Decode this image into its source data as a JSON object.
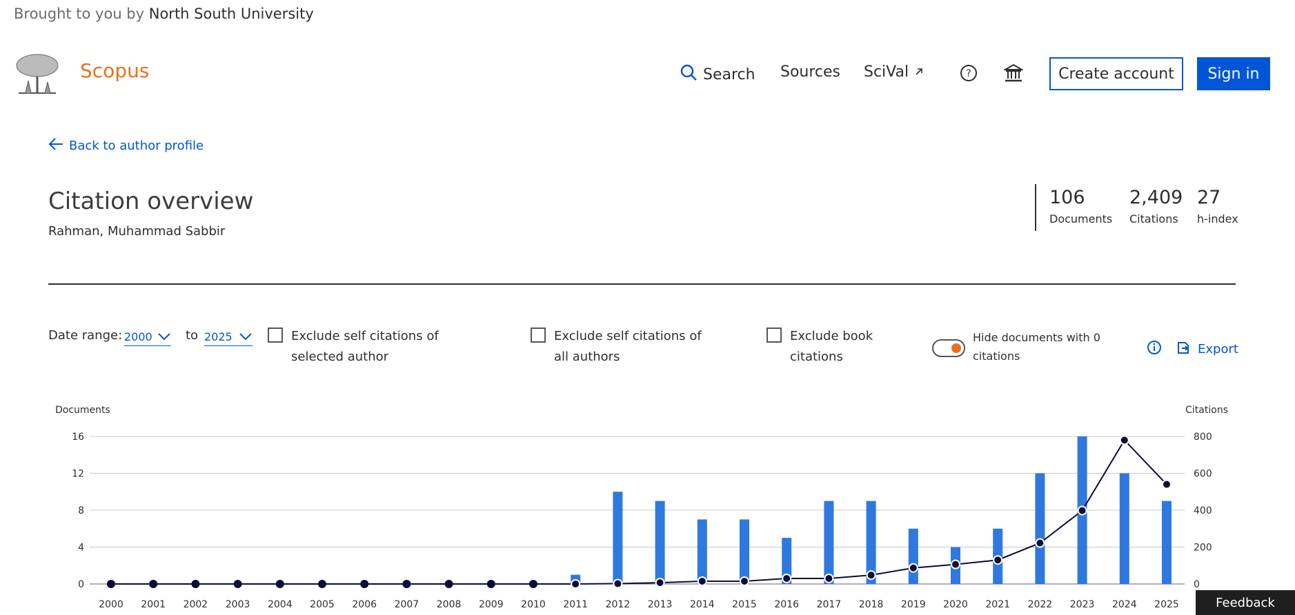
{
  "banner": {
    "prefix": "Brought to you by",
    "institution": "North South University"
  },
  "brand": {
    "name": "Scopus",
    "color": "#e9711c"
  },
  "nav": {
    "search": "Search",
    "sources": "Sources",
    "scival": "SciVal",
    "help_icon": "question-circle-icon",
    "institution_icon": "institution-icon",
    "create_account": "Create account",
    "sign_in": "Sign in"
  },
  "back_link": "Back to author profile",
  "page": {
    "title": "Citation overview",
    "author": "Rahman, Muhammad Sabbir"
  },
  "stats": [
    {
      "value": "106",
      "label": "Documents"
    },
    {
      "value": "2,409",
      "label": "Citations"
    },
    {
      "value": "27",
      "label": "h-index"
    }
  ],
  "filters": {
    "date_range_label": "Date range:",
    "from_year": "2000",
    "to_label": "to",
    "to_year": "2025",
    "exclude_self_selected": "Exclude self citations of selected author",
    "exclude_self_all": "Exclude self citations of all authors",
    "exclude_book": "Exclude book citations",
    "hide_zero": "Hide documents with 0 citations",
    "hide_zero_on": true,
    "export": "Export"
  },
  "feedback": "Feedback",
  "colors": {
    "accent": "#0056d6",
    "bar": "#2f78e0",
    "line": "#0b0b3b",
    "orange": "#e9711c"
  },
  "chart_data": {
    "type": "bar",
    "ylabel": "Documents",
    "y2label": "Citations",
    "ylim": [
      0,
      16
    ],
    "y2lim": [
      0,
      800
    ],
    "yticks": [
      0,
      4,
      8,
      12,
      16
    ],
    "y2ticks": [
      0,
      200,
      400,
      600,
      800
    ],
    "categories": [
      "2000",
      "2001",
      "2002",
      "2003",
      "2004",
      "2005",
      "2006",
      "2007",
      "2008",
      "2009",
      "2010",
      "2011",
      "2012",
      "2013",
      "2014",
      "2015",
      "2016",
      "2017",
      "2018",
      "2019",
      "2020",
      "2021",
      "2022",
      "2023",
      "2024",
      "2025"
    ],
    "series": [
      {
        "name": "Documents",
        "type": "bar",
        "axis": "left",
        "values": [
          0,
          0,
          0,
          0,
          0,
          0,
          0,
          0,
          0,
          0,
          0,
          1,
          10,
          9,
          7,
          7,
          5,
          9,
          9,
          6,
          4,
          6,
          12,
          16,
          12,
          9
        ]
      },
      {
        "name": "Citations",
        "type": "line",
        "axis": "right",
        "values": [
          0,
          0,
          0,
          0,
          0,
          0,
          0,
          0,
          0,
          0,
          0,
          0,
          2,
          7,
          15,
          15,
          30,
          30,
          48,
          87,
          106,
          130,
          222,
          398,
          780,
          540
        ]
      }
    ],
    "grid": true
  }
}
